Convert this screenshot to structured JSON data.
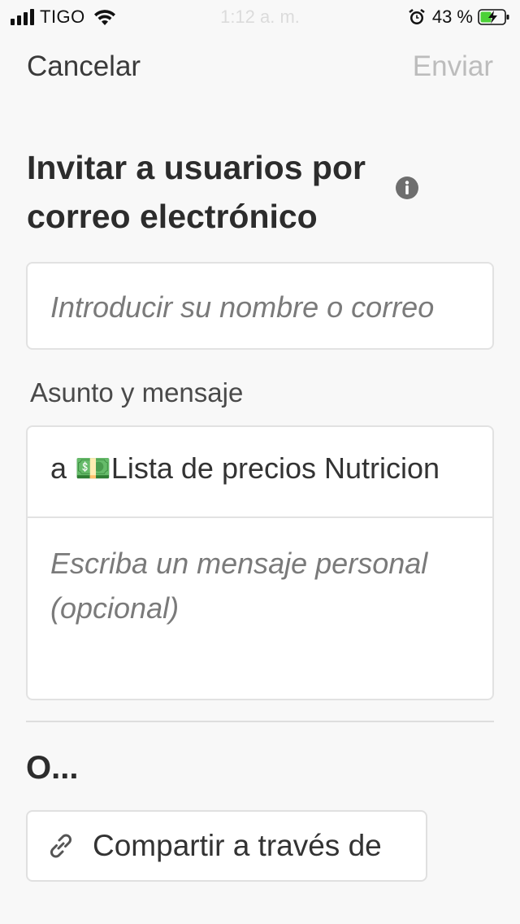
{
  "status_bar": {
    "carrier": "TIGO",
    "time": "1:12 a. m.",
    "battery_percent": "43 %"
  },
  "nav": {
    "cancel_label": "Cancelar",
    "send_label": "Enviar"
  },
  "invite": {
    "title": "Invitar a usuarios por correo electrónico",
    "email_placeholder": "Introducir su nombre o correo",
    "section_label": "Asunto y mensaje",
    "subject": "a 💵Lista de precios Nutricion",
    "message_placeholder": "Escriba un mensaje personal (opcional)"
  },
  "alternatives": {
    "or_label": "O...",
    "share_label": "Compartir a través de"
  },
  "colors": {
    "background": "#f8f8f8",
    "disabled_text": "#bcbcbc",
    "battery_charging": "#4cd137"
  },
  "icons": {
    "info": "info-icon",
    "link": "link-icon",
    "signal": "signal-icon",
    "wifi": "wifi-icon",
    "alarm": "alarm-icon",
    "battery": "battery-charging-icon"
  }
}
